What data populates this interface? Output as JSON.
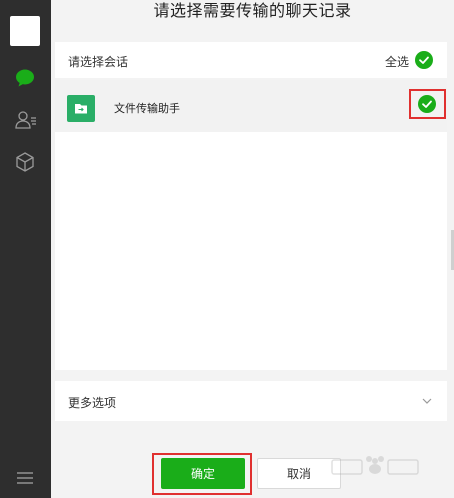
{
  "window": {
    "title": "请选择需要传输的聊天记录"
  },
  "sidebar": {
    "icons": [
      "chat-icon",
      "contacts-icon",
      "box-icon",
      "menu-icon"
    ],
    "active_color": "#1aad19"
  },
  "chat_select": {
    "header_label": "请选择会话",
    "select_all_label": "全选",
    "select_all_checked": true,
    "items": [
      {
        "label": "文件传输助手",
        "icon": "file-transfer-icon",
        "checked": true
      }
    ]
  },
  "more_options": {
    "label": "更多选项"
  },
  "buttons": {
    "confirm": "确定",
    "cancel": "取消"
  },
  "colors": {
    "accent": "#1aad19",
    "highlight_box": "#e0302f",
    "file_icon": "#2aae67"
  }
}
